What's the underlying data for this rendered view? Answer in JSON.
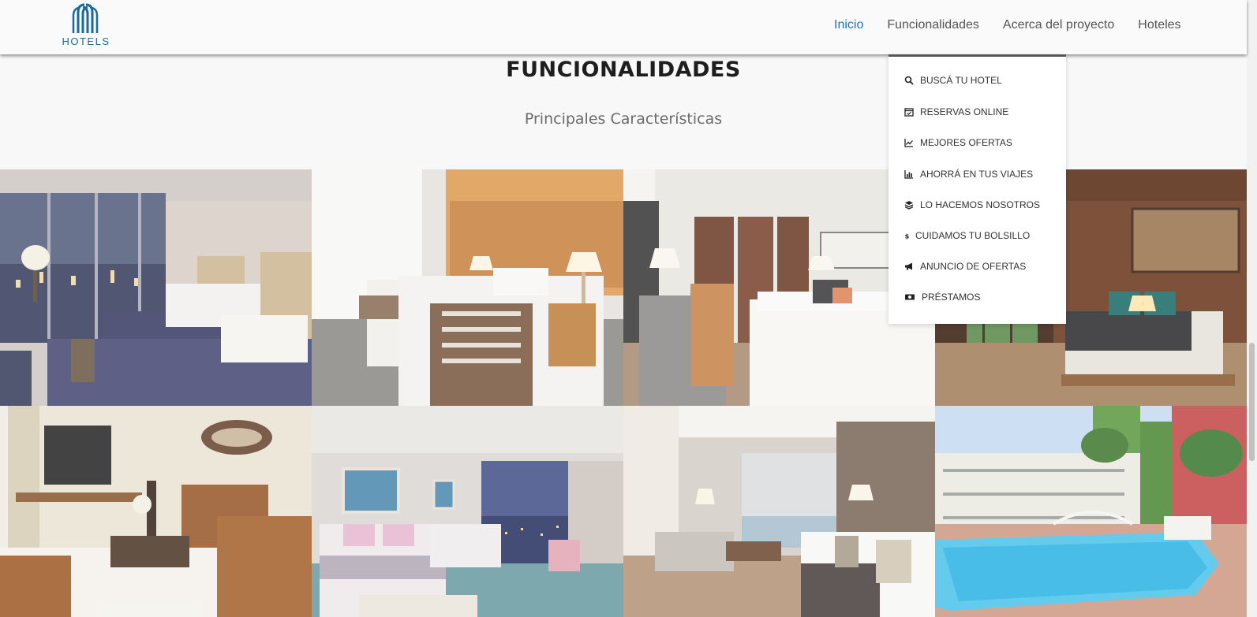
{
  "header": {
    "logo_text": "HOTELS",
    "nav": [
      {
        "label": "Inicio",
        "active": true
      },
      {
        "label": "Funcionalidades",
        "active": false
      },
      {
        "label": "Acerca del proyecto",
        "active": false
      },
      {
        "label": "Hoteles",
        "active": false
      }
    ]
  },
  "section": {
    "title": "FUNCIONALIDADES",
    "subtitle": "Principales Características"
  },
  "dropdown": {
    "items": [
      {
        "label": "BUSCÁ TU HOTEL",
        "icon": "search-icon"
      },
      {
        "label": "RESERVAS ONLINE",
        "icon": "calendar-check-icon"
      },
      {
        "label": "MEJORES OFERTAS",
        "icon": "line-chart-icon"
      },
      {
        "label": "AHORRÁ EN TUS VIAJES",
        "icon": "bar-chart-icon"
      },
      {
        "label": "LO HACEMOS NOSOTROS",
        "icon": "layers-icon"
      },
      {
        "label": "CUIDAMOS TU BOLSILLO",
        "icon": "dollar-icon"
      },
      {
        "label": "ANUNCIO DE OFERTAS",
        "icon": "megaphone-icon"
      },
      {
        "label": "PRÉSTAMOS",
        "icon": "money-icon"
      }
    ]
  },
  "gallery": {
    "images": [
      "hotel-room-city-view-photo",
      "twin-bed-room-photo",
      "hotel-suite-doors-photo",
      "wood-room-photo",
      "living-room-sofas-photo",
      "pink-twin-room-photo",
      "modern-room-balcony-photo",
      "hotel-pool-photo"
    ]
  },
  "colors": {
    "accent": "#1c74c4",
    "logo": "#1b6b9a"
  }
}
